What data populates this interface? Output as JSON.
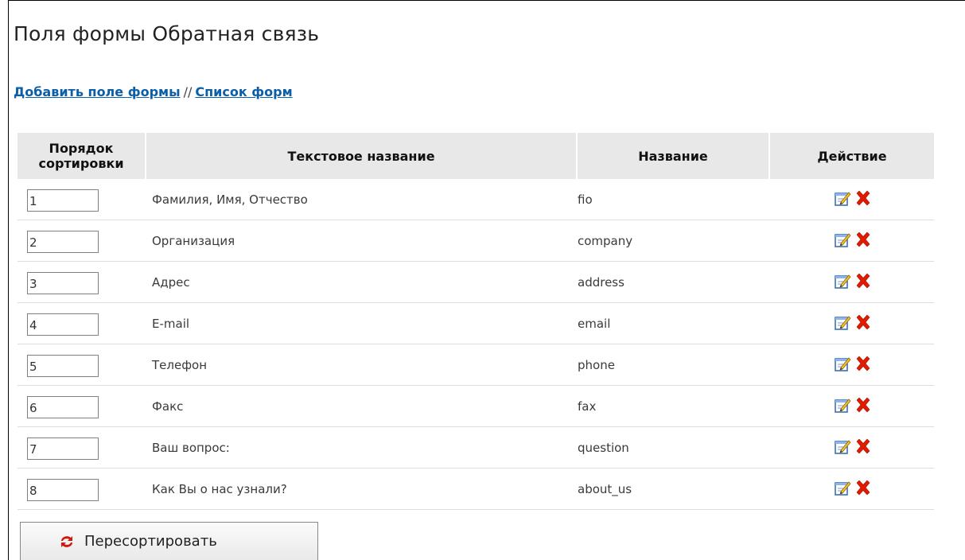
{
  "page": {
    "title": "Поля формы Обратная связь"
  },
  "links": {
    "add_field": "Добавить поле формы",
    "separator": "//",
    "form_list": "Список форм"
  },
  "table": {
    "headers": {
      "order_line1": "Порядок",
      "order_line2": "сортировки",
      "text_name": "Текстовое название",
      "name": "Название",
      "action": "Действие"
    },
    "rows": [
      {
        "order": "1",
        "text_name": "Фамилия, Имя, Отчество",
        "name": "fio"
      },
      {
        "order": "2",
        "text_name": "Организация",
        "name": "company"
      },
      {
        "order": "3",
        "text_name": "Адрес",
        "name": "address"
      },
      {
        "order": "4",
        "text_name": "E-mail",
        "name": "email"
      },
      {
        "order": "5",
        "text_name": "Телефон",
        "name": "phone"
      },
      {
        "order": "6",
        "text_name": "Факс",
        "name": "fax"
      },
      {
        "order": "7",
        "text_name": "Ваш вопрос:",
        "name": "question"
      },
      {
        "order": "8",
        "text_name": "Как Вы о нас узнали?",
        "name": "about_us"
      }
    ],
    "action_icons": [
      "edit-icon",
      "delete-icon"
    ]
  },
  "resort_button": {
    "label": "Пересортировать",
    "icon": "refresh-icon"
  },
  "colors": {
    "link": "#0b5ea8",
    "header_bg": "#e8e8e8",
    "delete_red": "#e11a00"
  }
}
